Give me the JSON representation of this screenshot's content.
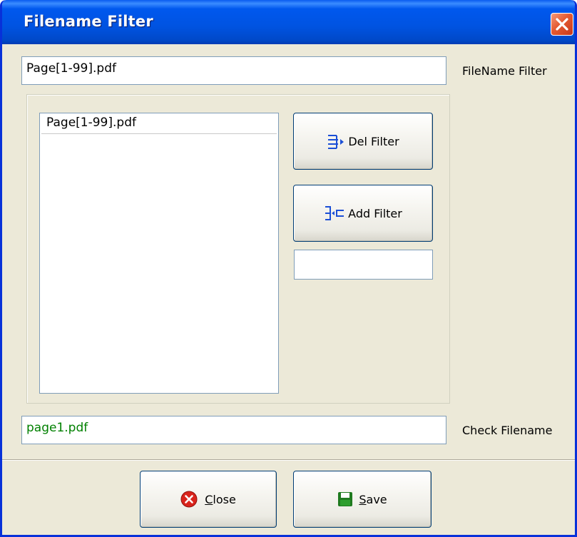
{
  "window": {
    "title": "Filename Filter"
  },
  "filter": {
    "value": "Page[1-99].pdf",
    "label": "FileName Filter"
  },
  "filter_list": {
    "items": [
      "Page[1-99].pdf"
    ]
  },
  "buttons": {
    "del_filter": "Del Filter",
    "add_filter": "Add Filter",
    "close": "Close",
    "save": "Save"
  },
  "new_filter": {
    "value": ""
  },
  "check": {
    "value": "page1.pdf",
    "label": "Check Filename",
    "text_color": "#008000"
  },
  "icons": {
    "title_close": "close-icon",
    "del_filter": "remove-filter-icon",
    "add_filter": "add-filter-icon",
    "close": "red-close-icon",
    "save": "floppy-disk-icon"
  }
}
